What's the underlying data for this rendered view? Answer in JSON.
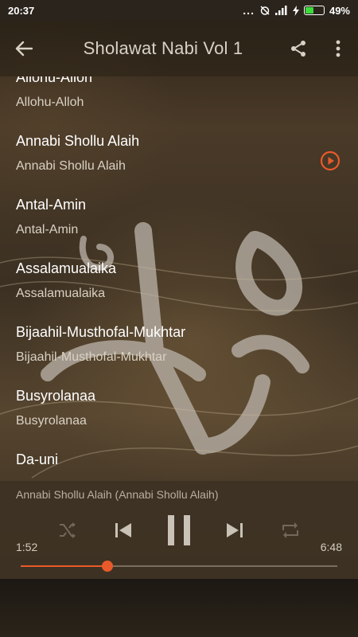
{
  "status_bar": {
    "time": "20:37",
    "dots": "...",
    "battery": "49%",
    "battery_level": 0.49,
    "icons": [
      "alarm-off-icon",
      "signal-icon",
      "charging-icon",
      "battery-icon"
    ]
  },
  "app_bar": {
    "title": "Sholawat Nabi Vol 1",
    "back_icon": "arrow-left-icon",
    "share_icon": "share-icon",
    "menu_icon": "more-vert-icon"
  },
  "tracks": [
    {
      "title": "Allohu-Alloh",
      "subtitle": "Allohu-Alloh",
      "playing": false
    },
    {
      "title": "Annabi Shollu Alaih",
      "subtitle": "Annabi Shollu Alaih",
      "playing": true
    },
    {
      "title": "Antal-Amin",
      "subtitle": "Antal-Amin",
      "playing": false
    },
    {
      "title": "Assalamualaika",
      "subtitle": "Assalamualaika",
      "playing": false
    },
    {
      "title": "Bijaahil-Musthofal-Mukhtar",
      "subtitle": "Bijaahil-Musthofal-Mukhtar",
      "playing": false
    },
    {
      "title": "Busyrolanaa",
      "subtitle": "Busyrolanaa",
      "playing": false
    },
    {
      "title": "Da-uni",
      "subtitle": "",
      "playing": false
    }
  ],
  "player": {
    "now_playing": "Annabi Shollu Alaih (Annabi Shollu Alaih)",
    "current_time": "1:52",
    "total_time": "6:48",
    "progress": 0.274,
    "controls": [
      "shuffle-icon",
      "skip-previous-icon",
      "pause-icon",
      "skip-next-icon",
      "repeat-icon"
    ]
  },
  "colors": {
    "accent": "#e85a2a",
    "title_text": "#d8d2c6"
  }
}
